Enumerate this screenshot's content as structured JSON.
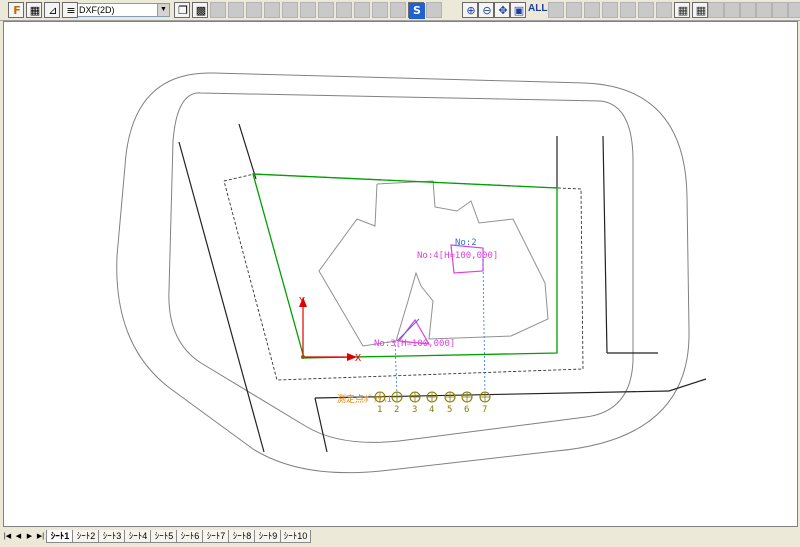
{
  "toolbar": {
    "view_mode_value": "DXF(2D)",
    "zoom_all_label": "ALL",
    "buttons": [
      {
        "icon": "file-icon",
        "glyph": "F",
        "enabled": true
      },
      {
        "icon": "layer-color-icon",
        "glyph": "▦",
        "enabled": true
      },
      {
        "icon": "edit-figure-icon",
        "glyph": "⊿",
        "enabled": true
      },
      {
        "icon": "list-icon",
        "glyph": "≡",
        "enabled": true
      },
      {
        "icon": "copy-icon",
        "glyph": "❐",
        "enabled": true
      },
      {
        "icon": "grid-icon",
        "glyph": "▩",
        "enabled": true
      },
      {
        "icon": "tool-icon",
        "glyph": "",
        "enabled": false
      },
      {
        "icon": "tool-icon",
        "glyph": "",
        "enabled": false
      },
      {
        "icon": "tool-icon",
        "glyph": "",
        "enabled": false
      },
      {
        "icon": "tool-icon",
        "glyph": "",
        "enabled": false
      },
      {
        "icon": "tool-icon",
        "glyph": "",
        "enabled": false
      },
      {
        "icon": "tool-icon",
        "glyph": "",
        "enabled": false
      },
      {
        "icon": "tool-icon",
        "glyph": "",
        "enabled": false
      },
      {
        "icon": "tool-icon",
        "glyph": "",
        "enabled": false
      },
      {
        "icon": "tool-icon",
        "glyph": "",
        "enabled": false
      },
      {
        "icon": "tool-icon",
        "glyph": "",
        "enabled": false
      },
      {
        "icon": "tool-icon",
        "glyph": "",
        "enabled": false
      },
      {
        "icon": "survey-icon",
        "glyph": "S",
        "enabled": true
      },
      {
        "icon": "tool-icon",
        "glyph": "",
        "enabled": false
      },
      {
        "icon": "zoom-in-icon",
        "glyph": "⊕",
        "enabled": true
      },
      {
        "icon": "zoom-out-icon",
        "glyph": "⊖",
        "enabled": true
      },
      {
        "icon": "pan-icon",
        "glyph": "✥",
        "enabled": true
      },
      {
        "icon": "zoom-window-icon",
        "glyph": "▣",
        "enabled": true
      },
      {
        "icon": "zoom-all-icon",
        "glyph": "ALL",
        "enabled": true
      },
      {
        "icon": "tool-icon",
        "glyph": "",
        "enabled": false
      },
      {
        "icon": "tool-icon",
        "glyph": "",
        "enabled": false
      },
      {
        "icon": "tool-icon",
        "glyph": "",
        "enabled": false
      },
      {
        "icon": "tool-icon",
        "glyph": "",
        "enabled": false
      },
      {
        "icon": "tool-icon",
        "glyph": "",
        "enabled": false
      },
      {
        "icon": "tool-icon",
        "glyph": "",
        "enabled": false
      },
      {
        "icon": "tool-icon",
        "glyph": "",
        "enabled": false
      },
      {
        "icon": "table-icon",
        "glyph": "▦",
        "enabled": true
      },
      {
        "icon": "table-icon",
        "glyph": "▦",
        "enabled": true
      },
      {
        "icon": "tool-icon",
        "glyph": "",
        "enabled": false
      },
      {
        "icon": "tool-icon",
        "glyph": "",
        "enabled": false
      },
      {
        "icon": "tool-icon",
        "glyph": "",
        "enabled": false
      },
      {
        "icon": "tool-icon",
        "glyph": "",
        "enabled": false
      },
      {
        "icon": "tool-icon",
        "glyph": "",
        "enabled": false
      },
      {
        "icon": "tool-icon",
        "glyph": "",
        "enabled": false
      }
    ]
  },
  "drawing": {
    "axis_y_label": "Y",
    "axis_x_label": "X",
    "label_no2": "No:2",
    "label_no4": "No:4[H=100,000]",
    "label_no3": "No:3[H=100,000]",
    "label_sensor": "測定点ﾎﾟｯｸｽ1",
    "point_numbers": [
      "1",
      "2",
      "3",
      "4",
      "5",
      "6",
      "7"
    ],
    "colors": {
      "green": "#00a000",
      "magenta": "#e040e0",
      "blue": "#3070e0",
      "red": "#e00000",
      "orange": "#e08000",
      "olive": "#8b7d00"
    }
  },
  "sheet_tabs": {
    "nav": [
      "|◀",
      "◀",
      "▶",
      "▶|"
    ],
    "labels": [
      "ｼｰﾄ1",
      "ｼｰﾄ2",
      "ｼｰﾄ3",
      "ｼｰﾄ4",
      "ｼｰﾄ5",
      "ｼｰﾄ6",
      "ｼｰﾄ7",
      "ｼｰﾄ8",
      "ｼｰﾄ9",
      "ｼｰﾄ10"
    ],
    "active_index": 0
  }
}
